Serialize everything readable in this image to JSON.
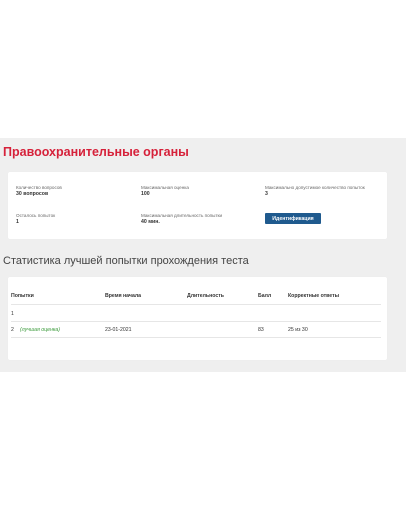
{
  "page": {
    "title": "Правоохранительные органы",
    "title_color": "#d6213a",
    "accent_button_color": "#1f5a8e"
  },
  "info": {
    "question_count": {
      "label": "Количество вопросов",
      "value": "30 вопросов"
    },
    "max_score": {
      "label": "Максимальная оценка",
      "value": "100"
    },
    "max_attempts": {
      "label": "Максимально допустимое количество попыток",
      "value": "3"
    },
    "remaining_attempts": {
      "label": "Осталось попыток",
      "value": "1"
    },
    "max_duration": {
      "label": "Максимальная длительность попытки",
      "value": "40 мин."
    },
    "identify_button": "Идентификация"
  },
  "stats": {
    "title": "Статистика лучшей попытки прохождения теста",
    "columns": [
      "Попытки",
      "Время начала",
      "Длительность",
      "Балл",
      "Корректные ответы"
    ],
    "rows": [
      {
        "attempt": "1",
        "note": "",
        "start": "",
        "duration": "",
        "score": "",
        "correct": ""
      },
      {
        "attempt": "2",
        "note": "(лучшая оценка)",
        "start": "23-01-2021",
        "duration": "",
        "score": "83",
        "correct": "25 из 30"
      }
    ]
  }
}
